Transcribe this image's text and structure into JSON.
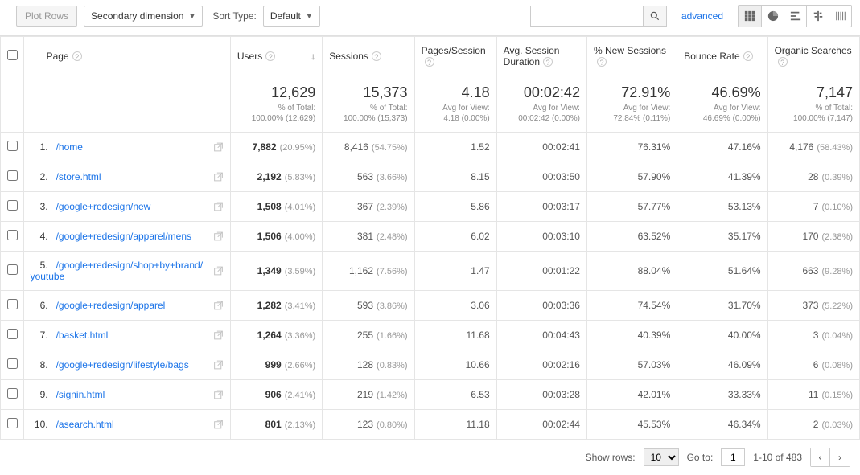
{
  "toolbar": {
    "plot_rows": "Plot Rows",
    "secondary_dim": "Secondary dimension",
    "sort_type_label": "Sort Type:",
    "sort_type_value": "Default",
    "advanced": "advanced"
  },
  "columns": {
    "page": "Page",
    "users": "Users",
    "sessions": "Sessions",
    "pages_session": "Pages/Session",
    "avg_duration": "Avg. Session Duration",
    "new_sessions": "% New Sessions",
    "bounce_rate": "Bounce Rate",
    "organic": "Organic Searches"
  },
  "summary": {
    "users": {
      "big": "12,629",
      "sub1": "% of Total:",
      "sub2": "100.00% (12,629)"
    },
    "sessions": {
      "big": "15,373",
      "sub1": "% of Total:",
      "sub2": "100.00% (15,373)"
    },
    "pages_session": {
      "big": "4.18",
      "sub1": "Avg for View:",
      "sub2": "4.18 (0.00%)"
    },
    "avg_duration": {
      "big": "00:02:42",
      "sub1": "Avg for View:",
      "sub2": "00:02:42 (0.00%)"
    },
    "new_sessions": {
      "big": "72.91%",
      "sub1": "Avg for View:",
      "sub2": "72.84% (0.11%)"
    },
    "bounce_rate": {
      "big": "46.69%",
      "sub1": "Avg for View:",
      "sub2": "46.69% (0.00%)"
    },
    "organic": {
      "big": "7,147",
      "sub1": "% of Total:",
      "sub2": "100.00% (7,147)"
    }
  },
  "rows": [
    {
      "idx": "1.",
      "page": "/home",
      "users": "7,882",
      "users_pct": "(20.95%)",
      "sessions": "8,416",
      "sessions_pct": "(54.75%)",
      "pps": "1.52",
      "dur": "00:02:41",
      "new": "76.31%",
      "bounce": "47.16%",
      "org": "4,176",
      "org_pct": "(58.43%)"
    },
    {
      "idx": "2.",
      "page": "/store.html",
      "users": "2,192",
      "users_pct": "(5.83%)",
      "sessions": "563",
      "sessions_pct": "(3.66%)",
      "pps": "8.15",
      "dur": "00:03:50",
      "new": "57.90%",
      "bounce": "41.39%",
      "org": "28",
      "org_pct": "(0.39%)"
    },
    {
      "idx": "3.",
      "page": "/google+redesign/new",
      "users": "1,508",
      "users_pct": "(4.01%)",
      "sessions": "367",
      "sessions_pct": "(2.39%)",
      "pps": "5.86",
      "dur": "00:03:17",
      "new": "57.77%",
      "bounce": "53.13%",
      "org": "7",
      "org_pct": "(0.10%)"
    },
    {
      "idx": "4.",
      "page": "/google+redesign/apparel/mens",
      "users": "1,506",
      "users_pct": "(4.00%)",
      "sessions": "381",
      "sessions_pct": "(2.48%)",
      "pps": "6.02",
      "dur": "00:03:10",
      "new": "63.52%",
      "bounce": "35.17%",
      "org": "170",
      "org_pct": "(2.38%)"
    },
    {
      "idx": "5.",
      "page": "/google+redesign/shop+by+brand/youtube",
      "users": "1,349",
      "users_pct": "(3.59%)",
      "sessions": "1,162",
      "sessions_pct": "(7.56%)",
      "pps": "1.47",
      "dur": "00:01:22",
      "new": "88.04%",
      "bounce": "51.64%",
      "org": "663",
      "org_pct": "(9.28%)"
    },
    {
      "idx": "6.",
      "page": "/google+redesign/apparel",
      "users": "1,282",
      "users_pct": "(3.41%)",
      "sessions": "593",
      "sessions_pct": "(3.86%)",
      "pps": "3.06",
      "dur": "00:03:36",
      "new": "74.54%",
      "bounce": "31.70%",
      "org": "373",
      "org_pct": "(5.22%)"
    },
    {
      "idx": "7.",
      "page": "/basket.html",
      "users": "1,264",
      "users_pct": "(3.36%)",
      "sessions": "255",
      "sessions_pct": "(1.66%)",
      "pps": "11.68",
      "dur": "00:04:43",
      "new": "40.39%",
      "bounce": "40.00%",
      "org": "3",
      "org_pct": "(0.04%)"
    },
    {
      "idx": "8.",
      "page": "/google+redesign/lifestyle/bags",
      "users": "999",
      "users_pct": "(2.66%)",
      "sessions": "128",
      "sessions_pct": "(0.83%)",
      "pps": "10.66",
      "dur": "00:02:16",
      "new": "57.03%",
      "bounce": "46.09%",
      "org": "6",
      "org_pct": "(0.08%)"
    },
    {
      "idx": "9.",
      "page": "/signin.html",
      "users": "906",
      "users_pct": "(2.41%)",
      "sessions": "219",
      "sessions_pct": "(1.42%)",
      "pps": "6.53",
      "dur": "00:03:28",
      "new": "42.01%",
      "bounce": "33.33%",
      "org": "11",
      "org_pct": "(0.15%)"
    },
    {
      "idx": "10.",
      "page": "/asearch.html",
      "users": "801",
      "users_pct": "(2.13%)",
      "sessions": "123",
      "sessions_pct": "(0.80%)",
      "pps": "11.18",
      "dur": "00:02:44",
      "new": "45.53%",
      "bounce": "46.34%",
      "org": "2",
      "org_pct": "(0.03%)"
    }
  ],
  "footer": {
    "show_rows_label": "Show rows:",
    "show_rows_value": "10",
    "goto_label": "Go to:",
    "goto_value": "1",
    "range": "1-10 of 483"
  },
  "chart_data": {
    "type": "table",
    "columns": [
      "Page",
      "Users",
      "Users %",
      "Sessions",
      "Sessions %",
      "Pages/Session",
      "Avg. Session Duration",
      "% New Sessions",
      "Bounce Rate",
      "Organic Searches",
      "Organic %"
    ],
    "rows": [
      [
        "/home",
        7882,
        20.95,
        8416,
        54.75,
        1.52,
        "00:02:41",
        76.31,
        47.16,
        4176,
        58.43
      ],
      [
        "/store.html",
        2192,
        5.83,
        563,
        3.66,
        8.15,
        "00:03:50",
        57.9,
        41.39,
        28,
        0.39
      ],
      [
        "/google+redesign/new",
        1508,
        4.01,
        367,
        2.39,
        5.86,
        "00:03:17",
        57.77,
        53.13,
        7,
        0.1
      ],
      [
        "/google+redesign/apparel/mens",
        1506,
        4.0,
        381,
        2.48,
        6.02,
        "00:03:10",
        63.52,
        35.17,
        170,
        2.38
      ],
      [
        "/google+redesign/shop+by+brand/youtube",
        1349,
        3.59,
        1162,
        7.56,
        1.47,
        "00:01:22",
        88.04,
        51.64,
        663,
        9.28
      ],
      [
        "/google+redesign/apparel",
        1282,
        3.41,
        593,
        3.86,
        3.06,
        "00:03:36",
        74.54,
        31.7,
        373,
        5.22
      ],
      [
        "/basket.html",
        1264,
        3.36,
        255,
        1.66,
        11.68,
        "00:04:43",
        40.39,
        40.0,
        3,
        0.04
      ],
      [
        "/google+redesign/lifestyle/bags",
        999,
        2.66,
        128,
        0.83,
        10.66,
        "00:02:16",
        57.03,
        46.09,
        6,
        0.08
      ],
      [
        "/signin.html",
        906,
        2.41,
        219,
        1.42,
        6.53,
        "00:03:28",
        42.01,
        33.33,
        11,
        0.15
      ],
      [
        "/asearch.html",
        801,
        2.13,
        123,
        0.8,
        11.18,
        "00:02:44",
        45.53,
        46.34,
        2,
        0.03
      ]
    ],
    "totals": {
      "Users": 12629,
      "Sessions": 15373,
      "Pages/Session": 4.18,
      "Avg. Session Duration": "00:02:42",
      "% New Sessions": 72.91,
      "Bounce Rate": 46.69,
      "Organic Searches": 7147
    }
  }
}
